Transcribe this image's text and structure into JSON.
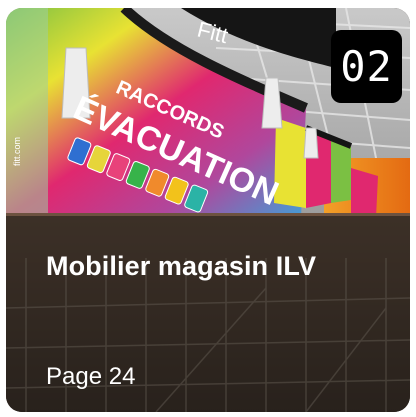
{
  "card": {
    "badge_number": "02",
    "title": "Mobilier magasin ILV",
    "page_label": "Page 24"
  },
  "photo": {
    "sign_logo": "Fitt",
    "sign_line1": "RACCORDS",
    "sign_line2": "ÉVACUATION",
    "sign_small_text": "fitt.com",
    "swatch_colors": [
      "#2f6fd1",
      "#e6d53a",
      "#e8427a",
      "#37b34a",
      "#f08a2c",
      "#f2c21b",
      "#2bb3a6"
    ],
    "sign_colors": {
      "pink": "#e0286f",
      "yellow": "#e8e233",
      "orange": "#ef7d1a",
      "green": "#7bc043",
      "dark": "#151515"
    }
  }
}
